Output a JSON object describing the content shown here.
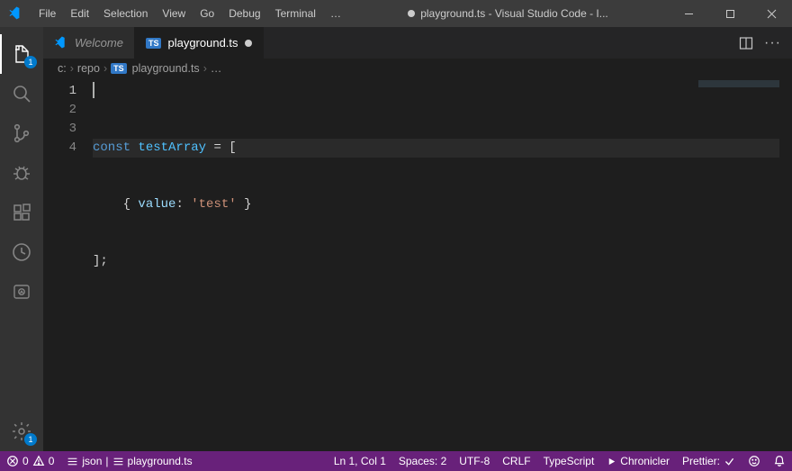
{
  "titlebar": {
    "menus": [
      "File",
      "Edit",
      "Selection",
      "View",
      "Go",
      "Debug",
      "Terminal",
      "…"
    ],
    "title": "playground.ts - Visual Studio Code - I..."
  },
  "activity": {
    "explorer_badge": "1",
    "settings_badge": "1"
  },
  "tabs": {
    "welcome": "Welcome",
    "playground": "playground.ts"
  },
  "breadcrumbs": {
    "c": "c:",
    "repo": "repo",
    "file": "playground.ts",
    "more": "…"
  },
  "editor": {
    "lines": {
      "n1": "1",
      "n2": "2",
      "n3": "3",
      "n4": "4"
    },
    "code": {
      "l1_kw": "const",
      "l1_sp1": " ",
      "l1_var": "testArray",
      "l1_rest": " = [",
      "l2_indent": "    { ",
      "l2_prop": "value",
      "l2_colon": ": ",
      "l2_str": "'test'",
      "l2_end": " }",
      "l3": "];"
    }
  },
  "status": {
    "errors": "0",
    "warnings": "0",
    "lang1": "json",
    "file": "playground.ts",
    "position": "Ln 1, Col 1",
    "spaces": "Spaces: 2",
    "encoding": "UTF-8",
    "eol": "CRLF",
    "language": "TypeScript",
    "chronicler": "Chronicler",
    "prettier": "Prettier:"
  }
}
